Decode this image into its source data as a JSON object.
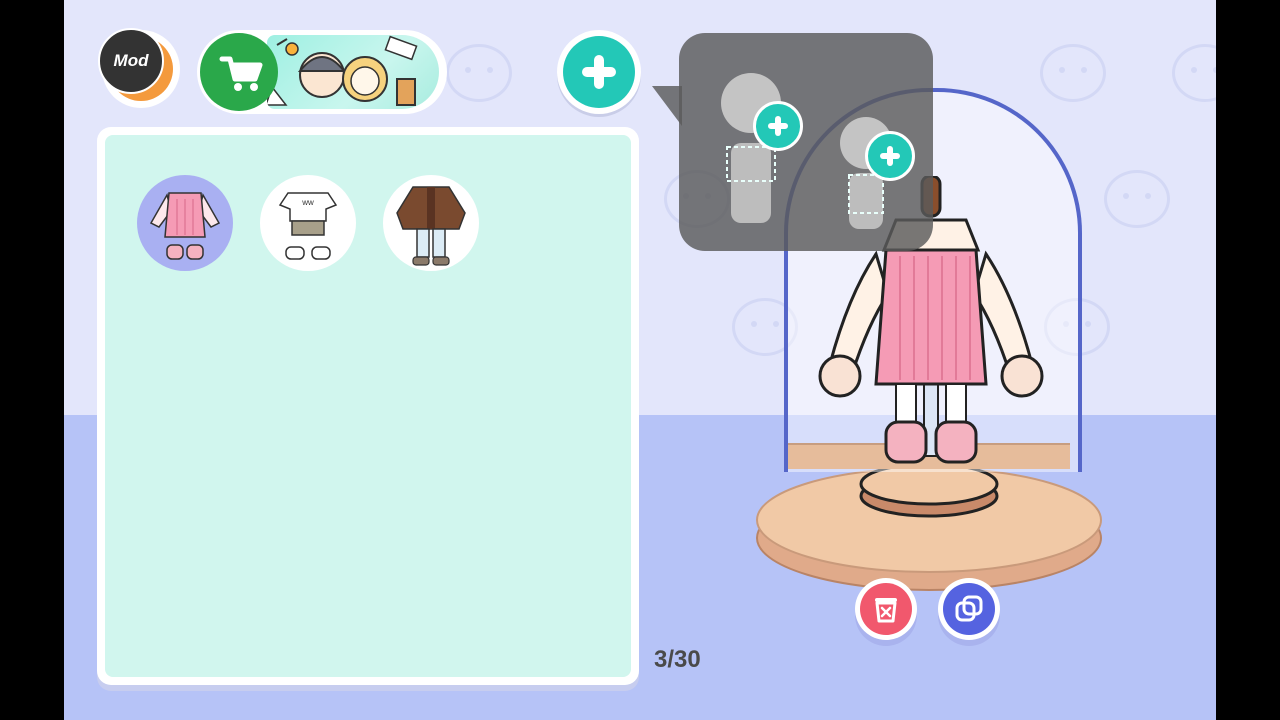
{
  "top_bar": {
    "mod_badge": "Mod",
    "mod_icon": "mod-badge-icon",
    "shop_icon": "shopping-cart-icon",
    "add_outfit_icon": "plus-icon"
  },
  "outfit_panel": {
    "outfits": [
      {
        "name": "pink-dress-outfit",
        "selected": true
      },
      {
        "name": "white-tee-shorts-outfit",
        "selected": false
      },
      {
        "name": "brown-jacket-jeans-outfit",
        "selected": false
      }
    ]
  },
  "slot_counter": "3/30",
  "mannequin_tooltip": {
    "options": [
      {
        "name": "adult-mannequin",
        "icon": "plus-icon"
      },
      {
        "name": "child-mannequin",
        "icon": "plus-icon"
      }
    ]
  },
  "actions": {
    "delete_icon": "trash-icon",
    "duplicate_icon": "duplicate-icon"
  },
  "colors": {
    "accent_teal": "#23c8b7",
    "shop_green": "#2aa84a",
    "delete_red": "#f1586d",
    "duplicate_blue": "#5563e0",
    "selection_purple": "#a9b0f2",
    "panel_mint": "#d1f6ee"
  }
}
